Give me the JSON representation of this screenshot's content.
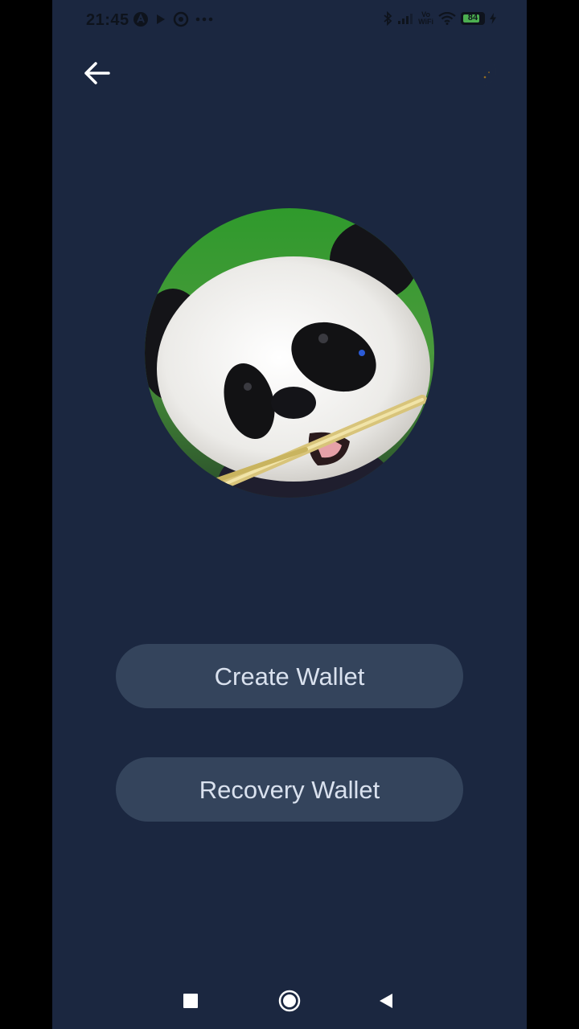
{
  "status_bar": {
    "time": "21:45",
    "battery_level": "84",
    "battery_fraction": 0.84,
    "network_label_top": "Vo",
    "network_label_bottom": "WiFi"
  },
  "header": {
    "back_icon": "arrow-left-icon",
    "theme_icon": "crescent-moon-icon"
  },
  "avatar": {
    "image": "panda-eating-bamboo"
  },
  "actions": {
    "create_label": "Create Wallet",
    "recover_label": "Recovery Wallet"
  },
  "nav": {
    "recents_icon": "square-icon",
    "home_icon": "circle-icon",
    "back_icon": "triangle-back-icon"
  },
  "colors": {
    "background": "#1b2740",
    "button": "#34445c",
    "button_text": "#d9e1ee",
    "moon": "#f5c93b"
  }
}
